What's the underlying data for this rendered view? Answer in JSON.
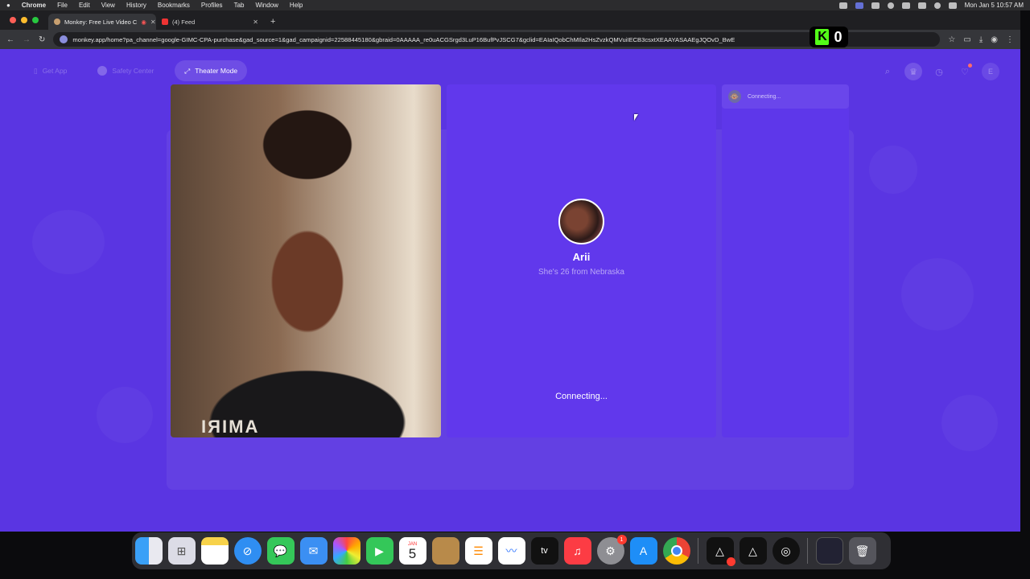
{
  "menubar": {
    "apple": "",
    "app": "Chrome",
    "items": [
      "File",
      "Edit",
      "View",
      "History",
      "Bookmarks",
      "Profiles",
      "Tab",
      "Window",
      "Help"
    ],
    "clock": "Mon Jan 5  10:57 AM"
  },
  "browser": {
    "tabs": [
      {
        "title": "Monkey: Free Live Video C",
        "active": true
      },
      {
        "title": "(4) Feed",
        "active": false
      }
    ],
    "new_tab": "+",
    "url": "monkey.app/home?pa_channel=google-GIMC-CPA-purchase&gad_source=1&gad_campaignid=22588445180&gbraid=0AAAAA_re0uACGSrgd3LuP16BufPvJSCG7&gclid=EAIaIQobChMIla2HsZvzkQMVuiIECB3csxtXEAAYASAAEgJQOvD_BwE",
    "kick_count": "0",
    "kick_letter": "K"
  },
  "nav": {
    "get_app": "Get App",
    "safety_center": "Safety Center",
    "theater_mode": "Theater Mode"
  },
  "selfcam": {
    "shirt_text": "AMIRI"
  },
  "remote": {
    "name": "Arii",
    "info": "She's 26 from Nebraska",
    "status": "Connecting..."
  },
  "chat": {
    "status": "Connecting..."
  },
  "dock": {
    "calendar_month": "JAN",
    "calendar_day": "5",
    "settings_badge": "1",
    "appletv": "tv"
  },
  "colors": {
    "page_bg": "#5a35e2",
    "panel_bg": "#6138ec"
  }
}
